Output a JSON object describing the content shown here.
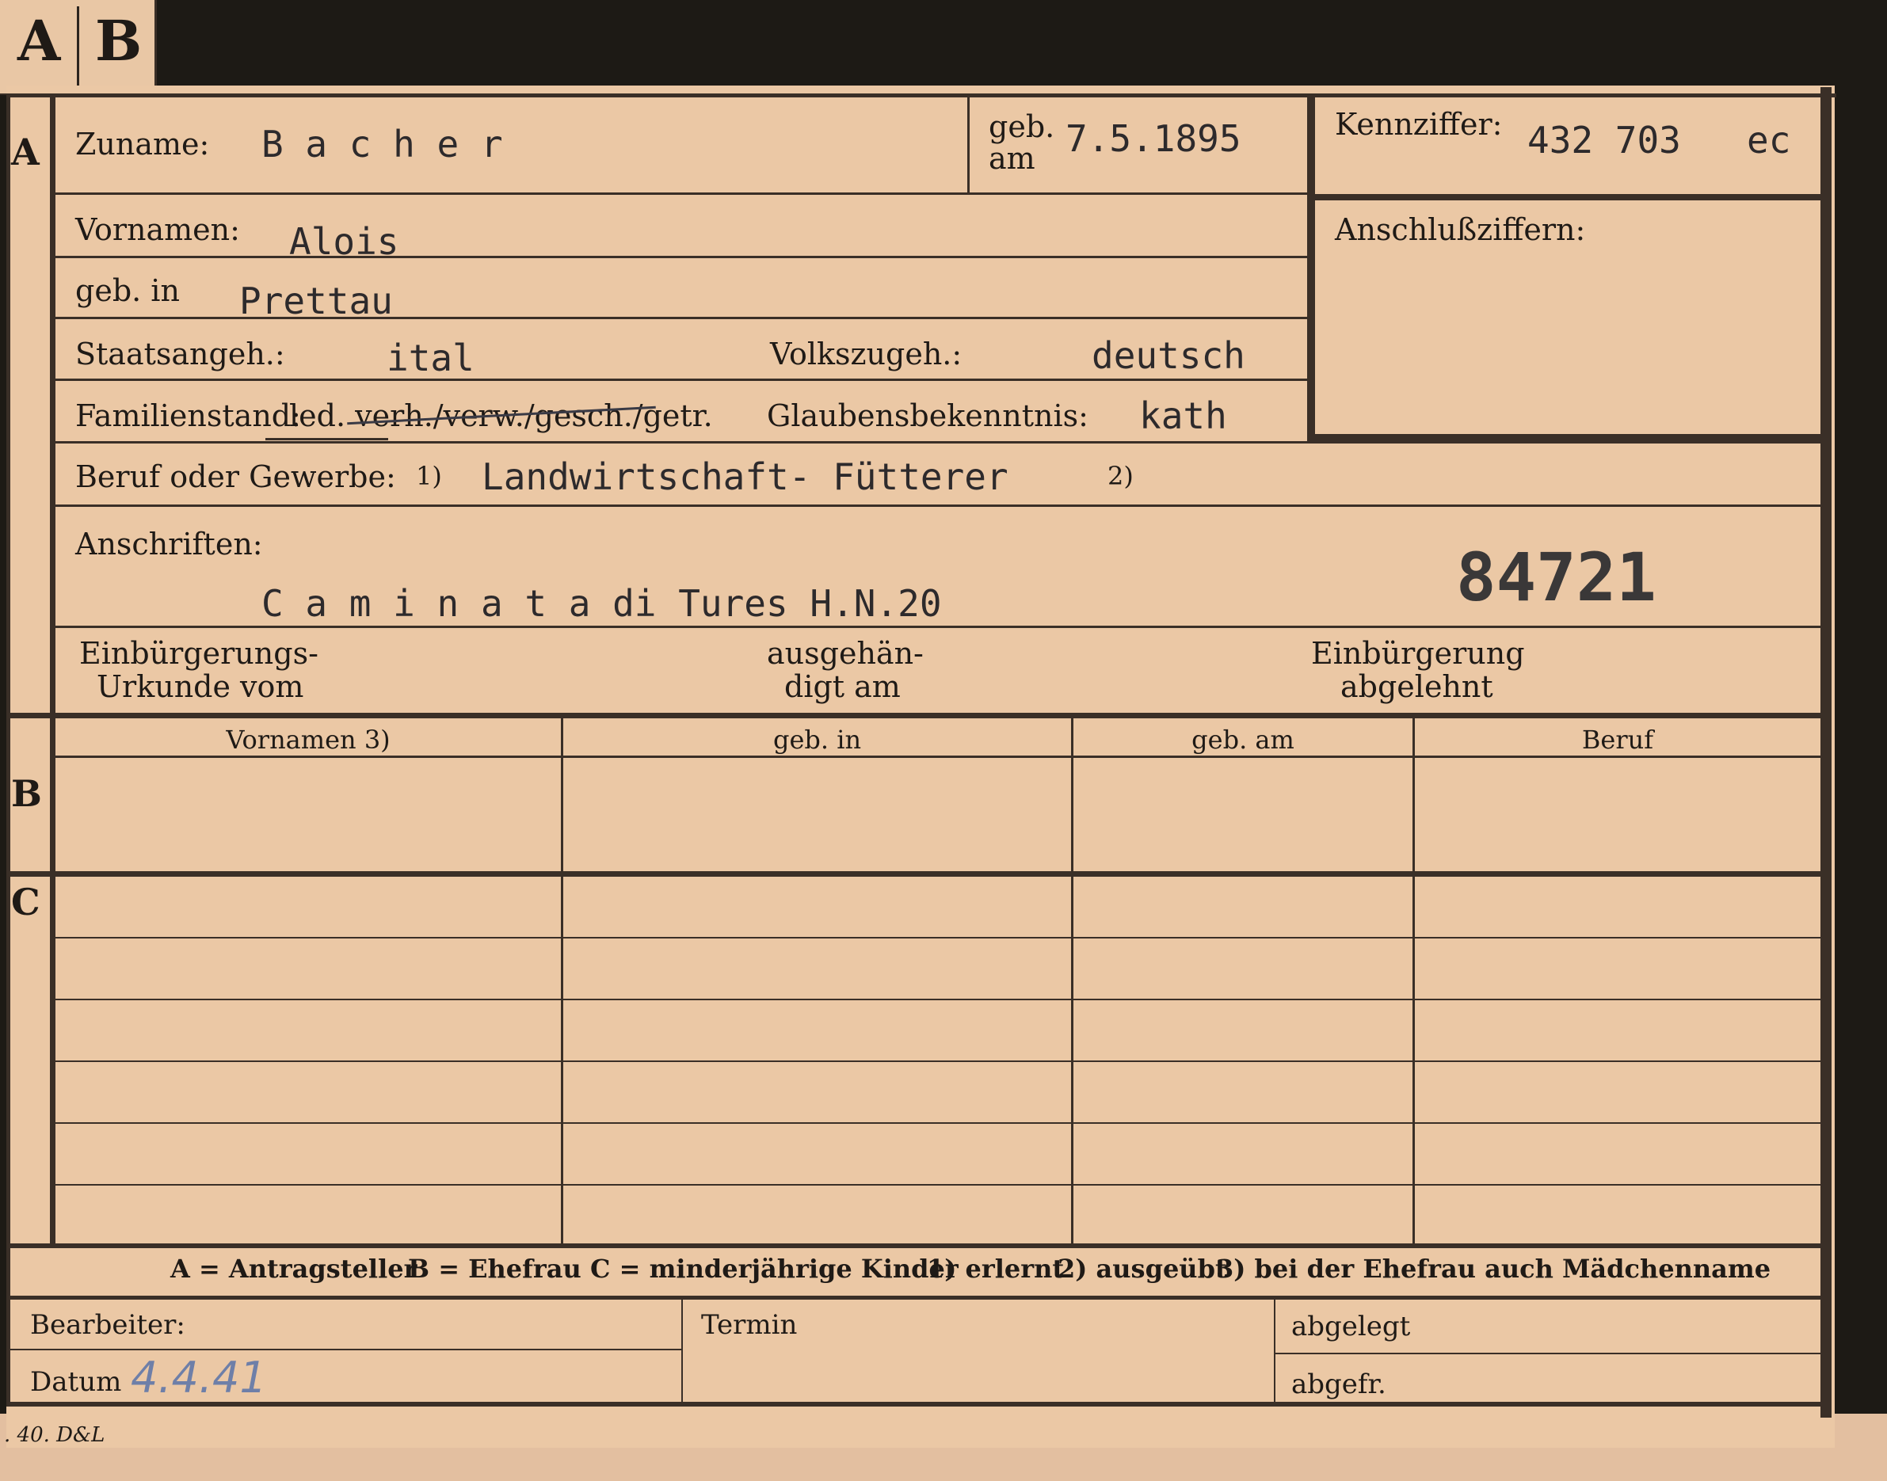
{
  "tabs": {
    "a": "A",
    "b": "B"
  },
  "section_letters": {
    "a": "A",
    "b": "B",
    "c": "C"
  },
  "section_a": {
    "zuname_label": "Zuname:",
    "zuname_value": "B a c h e r",
    "geb_am_label_1": "geb.",
    "geb_am_label_2": "am",
    "geb_am_value": "7.5.1895",
    "kennziffer_label": "Kennziffer:",
    "kennziffer_value": "432 703",
    "kennziffer_suffix": "ec",
    "anschlussziffern_label": "Anschlußziffern:",
    "vornamen_label": "Vornamen:",
    "vornamen_value": "Alois",
    "geb_in_label": "geb. in",
    "geb_in_value": "Prettau",
    "staatsangeh_label": "Staatsangeh.:",
    "staatsangeh_value": "ital",
    "volkszugeh_label": "Volkszugeh.:",
    "volkszugeh_value": "deutsch",
    "familienstand_label": "Familienstand:",
    "familienstand_options": "led. verh./verw./gesch./getr.",
    "glaubensbekenntnis_label": "Glaubensbekenntnis:",
    "glaubensbekenntnis_value": "kath",
    "beruf_label": "Beruf oder Gewerbe:",
    "beruf_note1": "1)",
    "beruf_value": "Landwirtschaft- Fütterer",
    "beruf_note2": "2)",
    "anschriften_label": "Anschriften:",
    "anschriften_value": "C a m i n a t a   di Tures H.N.20",
    "stamp_number": "84721",
    "einbuergerung_urkunde_1": "Einbürgerungs-",
    "einbuergerung_urkunde_2": "Urkunde vom",
    "ausgehaendigt_1": "ausgehän-",
    "ausgehaendigt_2": "digt am",
    "abgelehnt_1": "Einbürgerung",
    "abgelehnt_2": "abgelehnt"
  },
  "table": {
    "headers": [
      "Vornamen 3)",
      "geb. in",
      "geb. am",
      "Beruf"
    ]
  },
  "legend": {
    "a": "A = Antragsteller",
    "b": "B = Ehefrau",
    "c": "C = minderjährige Kinder",
    "n1": "1) erlernt",
    "n2": "2) ausgeübt",
    "n3": "3) bei der Ehefrau auch Mädchenname"
  },
  "footer": {
    "bearbeiter_label": "Bearbeiter:",
    "datum_label": "Datum",
    "datum_value": "4.4.41",
    "termin_label": "Termin",
    "abgelegt_label": "abgelegt",
    "abgefr_label": "abgefr.",
    "print_code": ". 40. D&L"
  }
}
